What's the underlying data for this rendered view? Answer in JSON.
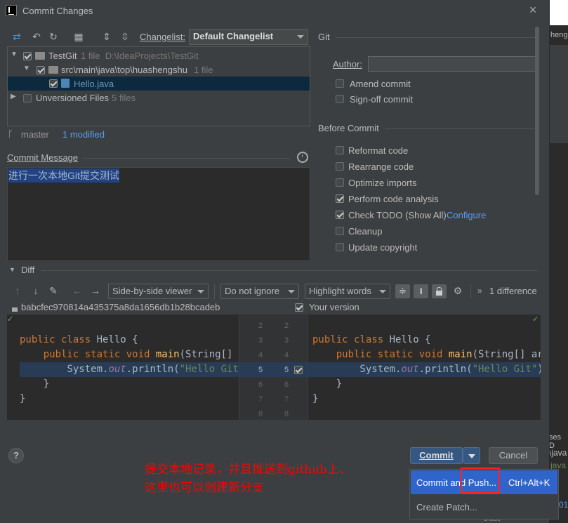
{
  "window": {
    "title": "Commit Changes"
  },
  "toolbar": {
    "changelist_label": "Changelist:",
    "changelist_value": "Default Changelist"
  },
  "tree": {
    "root": {
      "name": "TestGit",
      "meta": "1 file",
      "path": "D:\\IdeaProjects\\TestGit"
    },
    "pkg": {
      "name": "src\\main\\java\\top\\huashengshu",
      "meta": "1 file"
    },
    "file": {
      "name": "Hello.java"
    },
    "unversioned": {
      "name": "Unversioned Files",
      "meta": "5 files"
    }
  },
  "status": {
    "branch": "master",
    "modified": "1 modified"
  },
  "commit_message": {
    "label": "Commit Message",
    "text": "进行一次本地Git提交测试"
  },
  "git": {
    "section": "Git",
    "author_label": "Author:",
    "author_value": "",
    "amend": "Amend commit",
    "signoff": "Sign-off commit"
  },
  "before_commit": {
    "section": "Before Commit",
    "reformat": "Reformat code",
    "rearrange": "Rearrange code",
    "optimize": "Optimize imports",
    "analysis": "Perform code analysis",
    "todo": "Check TODO (Show All)",
    "configure": "Configure",
    "cleanup": "Cleanup",
    "copyright": "Update copyright"
  },
  "diff": {
    "label": "Diff",
    "viewer": "Side-by-side viewer",
    "ignore": "Do not ignore",
    "highlight": "Highlight words",
    "differences": "1 difference",
    "left_rev": "babcfec970814a435375a8da1656db1b28bcadeb",
    "right_rev": "Your version",
    "left_lines": [
      "",
      "public class Hello {",
      "    public static void main(String[] ar",
      "        System.out.println(\"Hello Git\")",
      "    }",
      "}",
      ""
    ],
    "right_lines": [
      "",
      "public class Hello {",
      "    public static void main(String[] args",
      "        System.out.println(\"Hello Git\");/",
      "    }",
      "}",
      ""
    ],
    "line_numbers": [
      "2",
      "3",
      "4",
      "5",
      "6",
      "7",
      "8"
    ]
  },
  "footer": {
    "help": "?",
    "commit": "Commit",
    "cancel": "Cancel"
  },
  "popup": {
    "commit_push": "Commit and Push...",
    "shortcut": "Ctrl+Alt+K",
    "create_patch": "Create Patch..."
  },
  "annotation": {
    "line1": "提交本地记录，并且推送到github上、",
    "line2": "这里也可以创建新分支"
  },
  "background_fragments": {
    "right1": "heng",
    "right2": "ses D",
    "right3": "\\java",
    "right4": "java",
    "right5": "01",
    "bottom": "Class"
  },
  "colors": {
    "dialog_bg": "#3c3f41",
    "editor_bg": "#2b2b2b",
    "selection": "#0d293e",
    "accent_blue": "#365880",
    "annotation_red": "#ff0000",
    "link_blue": "#589df6"
  }
}
